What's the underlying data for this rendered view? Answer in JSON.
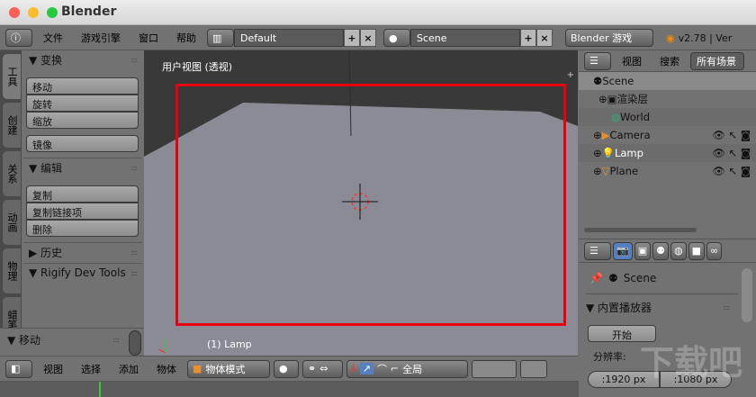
{
  "window": {
    "title": "Blender"
  },
  "info_header": {
    "menus": [
      "文件",
      "游戏引擎",
      "窗口",
      "帮助"
    ],
    "layout": "Default",
    "scene": "Scene",
    "engine": "Blender 游戏",
    "version": "v2.78 | Ver"
  },
  "tool_tabs": [
    "工具",
    "创建",
    "关系",
    "动画",
    "物理",
    "蜡笔"
  ],
  "tool_panel": {
    "transform": {
      "title": "变换",
      "buttons": [
        "移动",
        "旋转",
        "缩放"
      ],
      "mirror": "镜像"
    },
    "edit": {
      "title": "编辑",
      "buttons": [
        "复制",
        "复制链接项",
        "删除"
      ]
    },
    "history": "历史",
    "rigify": "Rigify Dev Tools",
    "operator": "移动"
  },
  "viewport": {
    "label": "用户视图 (透视)",
    "object": "(1) Lamp"
  },
  "view3d_header": {
    "menus": [
      "视图",
      "选择",
      "添加",
      "物体"
    ],
    "mode": "物体模式",
    "pivot": "全局"
  },
  "outliner": {
    "menus": [
      "视图",
      "搜索"
    ],
    "filter": "所有场景",
    "items": [
      "Scene",
      "渲染层",
      "World",
      "Camera",
      "Lamp",
      "Plane"
    ]
  },
  "properties": {
    "scene": "Scene",
    "panel": "内置播放器",
    "start": "开始",
    "resolution_label": "分辨率:",
    "res_x": ":1920 px",
    "res_y": ":1080 px"
  },
  "watermark": "下载吧"
}
